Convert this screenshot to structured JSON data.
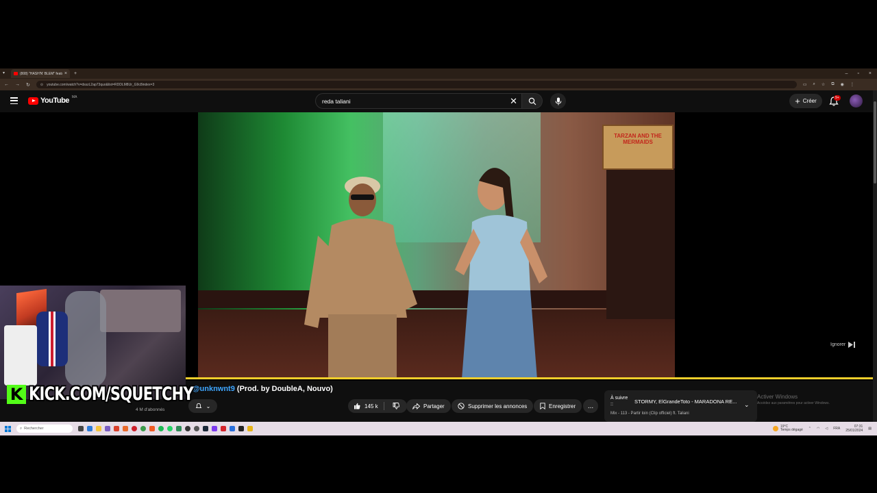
{
  "browser": {
    "tab_title": "(808) \"HASH'N' BLEM\" featu",
    "url": "youtube.com/watch?v=dsszL2ap73quo&list=RDDLM8Ur_G9c8index=3"
  },
  "youtube": {
    "logo_text": "YouTube",
    "region": "MA",
    "search_value": "reda taliani",
    "create_label": "Créer",
    "notif_badge": "9+"
  },
  "video": {
    "skip_label": "Ignorer",
    "progress_fraction": 1.0,
    "scene": {
      "poster_text": "TARZAN AND THE MERMAIDS"
    }
  },
  "below": {
    "title_prefix": "t. ",
    "title_mention": "@unknwnt9",
    "title_suffix": " (Prod. by DoubleA, Nouvo)",
    "subs": "4 M d'abonnés",
    "likes": "145 k",
    "share_label": "Partager",
    "noads_label": "Supprimer les annonces",
    "save_label": "Enregistrer",
    "more_label": "..."
  },
  "upnext": {
    "label": "À suivre ::",
    "title": "STORMY, ElGrandeToto - MARADONA RE...",
    "subtitle": "Mix - 113 - Partir loin (Clip officiel) ft. Taliani"
  },
  "activate_windows": {
    "line1": "Activer Windows",
    "line2": "Accédez aux paramètres pour activer Windows."
  },
  "taskbar": {
    "search_placeholder": "Rechercher",
    "weather_temp": "19°C",
    "weather_text": "Temps dégagé",
    "lang": "FRA",
    "time": "07:31",
    "date": "25/01/2024"
  },
  "overlay": {
    "kick_text": "KICK.COM/SQUETCHY"
  },
  "colors": {
    "progress": "#f2cf2b",
    "yt_red": "#ff0000",
    "kick_green": "#53fc18",
    "mention": "#3ea6ff"
  }
}
